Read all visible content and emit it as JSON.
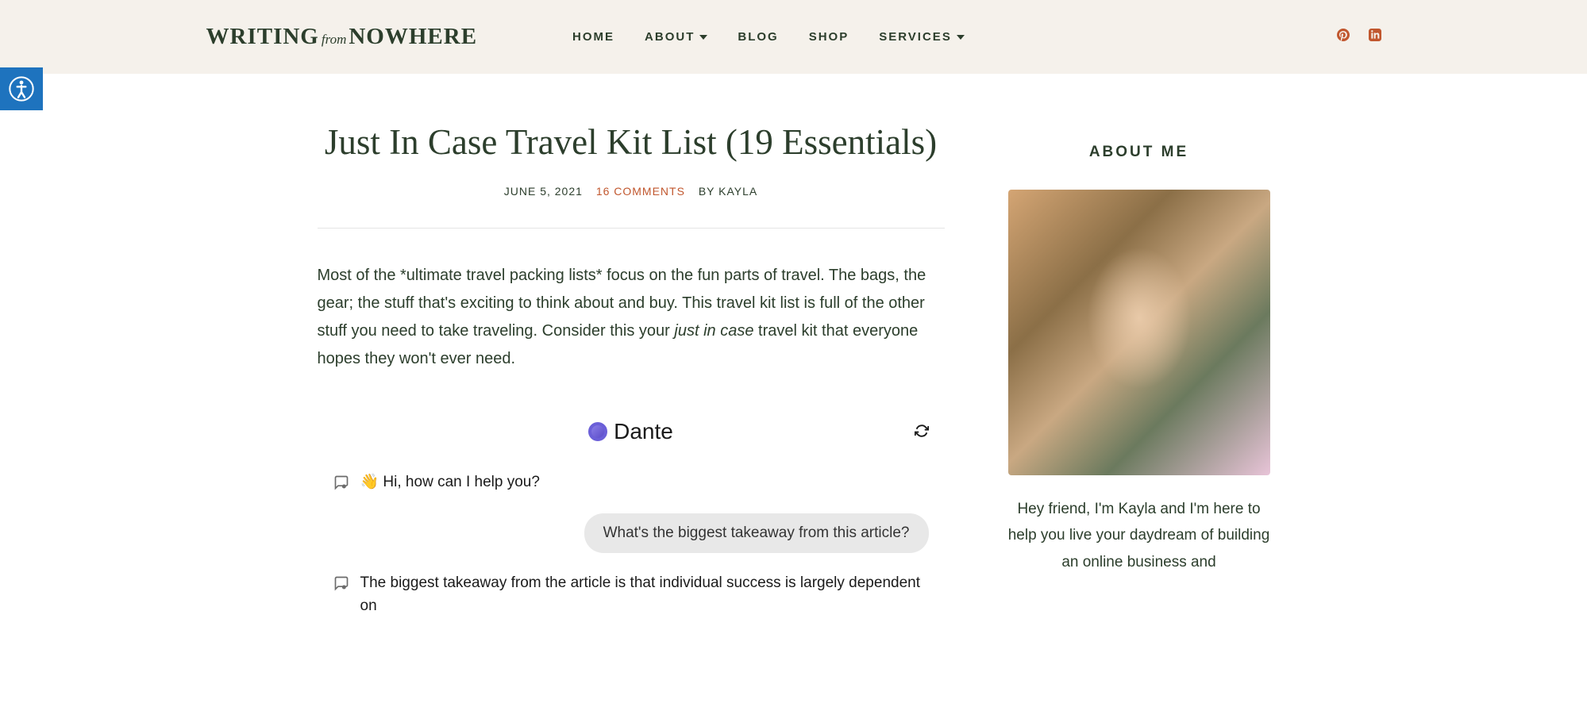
{
  "site": {
    "logo_pre": "WRITING",
    "logo_mid": "from",
    "logo_post": "NOWHERE"
  },
  "nav": {
    "items": [
      {
        "label": "HOME",
        "dropdown": false
      },
      {
        "label": "ABOUT",
        "dropdown": true
      },
      {
        "label": "BLOG",
        "dropdown": false
      },
      {
        "label": "SHOP",
        "dropdown": false
      },
      {
        "label": "SERVICES",
        "dropdown": true
      }
    ]
  },
  "socials": {
    "pinterest": "pinterest-icon",
    "linkedin": "linkedin-icon"
  },
  "article": {
    "title": "Just In Case Travel Kit List (19 Essentials)",
    "date": "JUNE 5, 2021",
    "comments": "16 COMMENTS",
    "byline_prefix": "BY ",
    "author": "KAYLA",
    "body_1": "Most of the *ultimate travel packing lists* focus on the fun parts of travel. The bags, the gear; the stuff that's exciting to think about and buy. This travel kit list is full of the other stuff you need to take traveling. Consider this your ",
    "body_em": "just in case",
    "body_2": " travel kit that everyone hopes they won't ever need."
  },
  "chat": {
    "brand": "Dante",
    "messages": [
      {
        "role": "bot",
        "text": "👋 Hi, how can I help you?"
      },
      {
        "role": "user",
        "text": "What's the biggest takeaway from this article?"
      },
      {
        "role": "bot",
        "text": "The biggest takeaway from the article is that individual success is largely dependent on"
      }
    ]
  },
  "sidebar": {
    "heading": "ABOUT ME",
    "text": "Hey friend, I'm Kayla and I'm here to help you live your daydream of building an online business and"
  }
}
